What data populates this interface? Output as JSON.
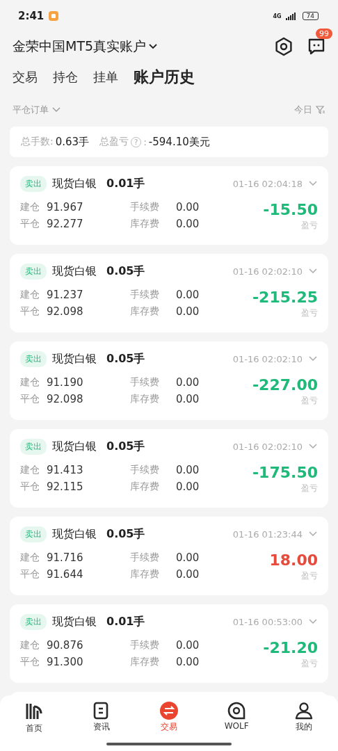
{
  "status_bar": {
    "time": "2:41",
    "network": "4G",
    "battery": "74"
  },
  "header": {
    "account": "金荣中国MT5真实账户",
    "badge": "99"
  },
  "tabs": [
    {
      "label": "交易",
      "selected": false
    },
    {
      "label": "持仓",
      "selected": false
    },
    {
      "label": "挂单",
      "selected": false
    },
    {
      "label": "账户历史",
      "selected": true
    }
  ],
  "filter": {
    "order_type": "平仓订单",
    "period": "今日"
  },
  "summary": {
    "lots_label": "总手数:",
    "lots": "0.63手",
    "pl_label": "总盈亏",
    "pl_help": "?",
    "pl_colon": ":",
    "pl": "-594.10美元"
  },
  "orders": [
    {
      "side": "卖出",
      "symbol": "现货白银",
      "lots": "0.01手",
      "time": "01-16 02:04:18",
      "open_label": "建仓",
      "open": "91.967",
      "close_label": "平仓",
      "close": "92.277",
      "fee_label": "手续费",
      "fee": "0.00",
      "swap_label": "库存费",
      "swap": "0.00",
      "profit": "-15.50",
      "profit_label": "盈亏",
      "color": "#1fb97a"
    },
    {
      "side": "卖出",
      "symbol": "现货白银",
      "lots": "0.05手",
      "time": "01-16 02:02:10",
      "open_label": "建仓",
      "open": "91.237",
      "close_label": "平仓",
      "close": "92.098",
      "fee_label": "手续费",
      "fee": "0.00",
      "swap_label": "库存费",
      "swap": "0.00",
      "profit": "-215.25",
      "profit_label": "盈亏",
      "color": "#1fb97a"
    },
    {
      "side": "卖出",
      "symbol": "现货白银",
      "lots": "0.05手",
      "time": "01-16 02:02:10",
      "open_label": "建仓",
      "open": "91.190",
      "close_label": "平仓",
      "close": "92.098",
      "fee_label": "手续费",
      "fee": "0.00",
      "swap_label": "库存费",
      "swap": "0.00",
      "profit": "-227.00",
      "profit_label": "盈亏",
      "color": "#1fb97a"
    },
    {
      "side": "卖出",
      "symbol": "现货白银",
      "lots": "0.05手",
      "time": "01-16 02:02:10",
      "open_label": "建仓",
      "open": "91.413",
      "close_label": "平仓",
      "close": "92.115",
      "fee_label": "手续费",
      "fee": "0.00",
      "swap_label": "库存费",
      "swap": "0.00",
      "profit": "-175.50",
      "profit_label": "盈亏",
      "color": "#1fb97a"
    },
    {
      "side": "卖出",
      "symbol": "现货白银",
      "lots": "0.05手",
      "time": "01-16 01:23:44",
      "open_label": "建仓",
      "open": "91.716",
      "close_label": "平仓",
      "close": "91.644",
      "fee_label": "手续费",
      "fee": "0.00",
      "swap_label": "库存费",
      "swap": "0.00",
      "profit": "18.00",
      "profit_label": "盈亏",
      "color": "#e64a3b"
    },
    {
      "side": "卖出",
      "symbol": "现货白银",
      "lots": "0.01手",
      "time": "01-16 00:53:00",
      "open_label": "建仓",
      "open": "90.876",
      "close_label": "平仓",
      "close": "91.300",
      "fee_label": "手续费",
      "fee": "0.00",
      "swap_label": "库存费",
      "swap": "0.00",
      "profit": "-21.20",
      "profit_label": "盈亏",
      "color": "#1fb97a"
    }
  ],
  "nav": [
    {
      "label": "首页",
      "selected": false
    },
    {
      "label": "资讯",
      "selected": false
    },
    {
      "label": "交易",
      "selected": true
    },
    {
      "label": "WOLF",
      "selected": false
    },
    {
      "label": "我的",
      "selected": false
    }
  ]
}
